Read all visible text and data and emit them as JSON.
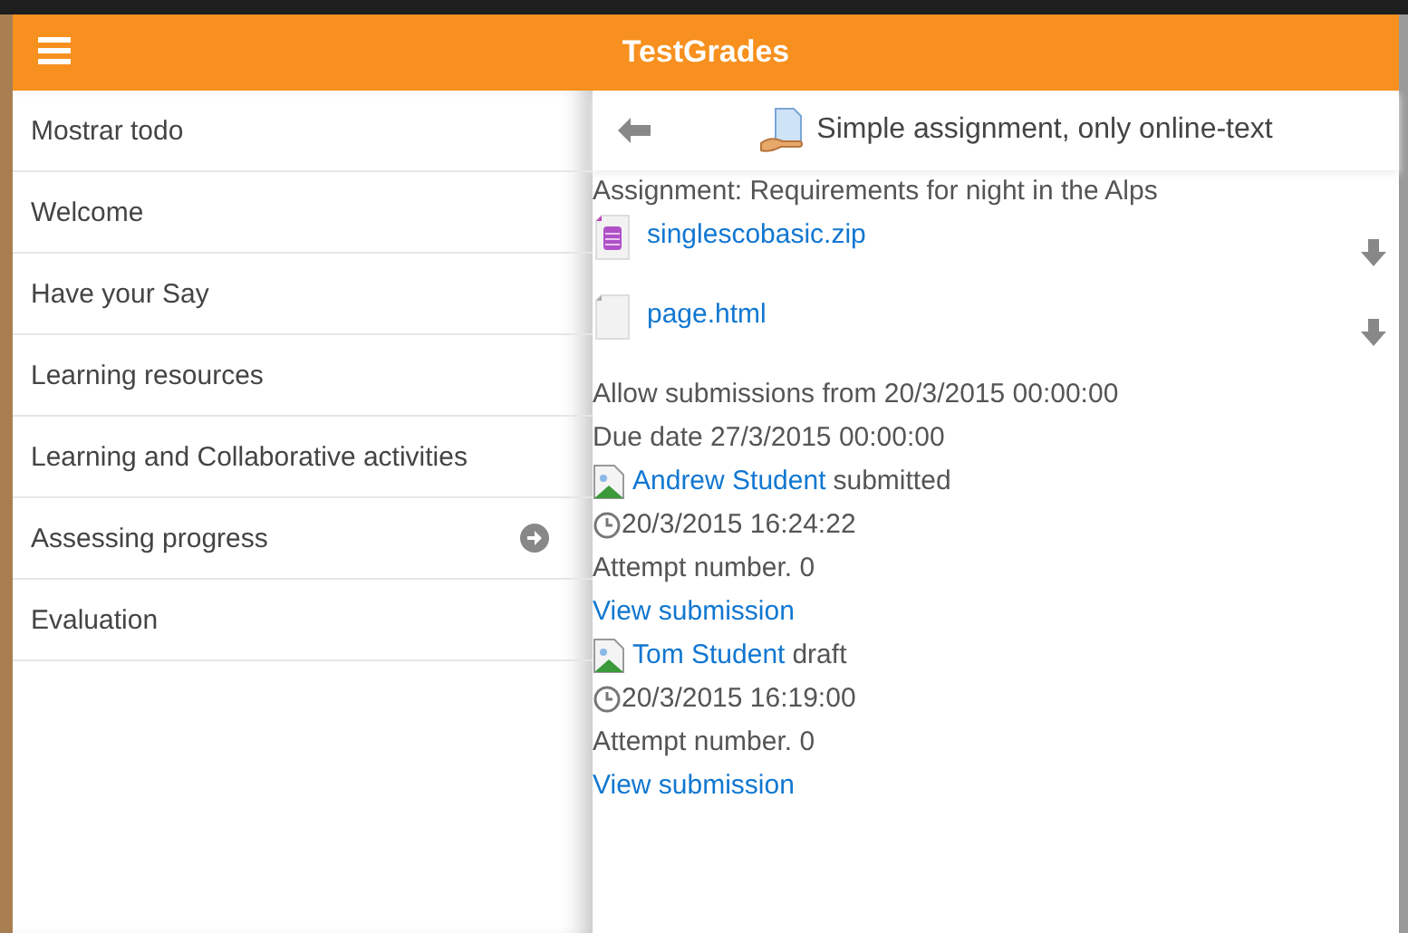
{
  "header": {
    "title": "TestGrades"
  },
  "sidebar": {
    "items": [
      {
        "label": "Mostrar todo",
        "has_arrow": false
      },
      {
        "label": "Welcome",
        "has_arrow": false
      },
      {
        "label": "Have your Say",
        "has_arrow": false
      },
      {
        "label": "Learning resources",
        "has_arrow": false
      },
      {
        "label": "Learning and Collaborative activities",
        "has_arrow": false
      },
      {
        "label": "Assessing progress",
        "has_arrow": true
      },
      {
        "label": "Evaluation",
        "has_arrow": false
      }
    ]
  },
  "content": {
    "title": "Simple assignment, only online-text",
    "assignment": "Assignment: Requirements for night in the Alps",
    "files": [
      {
        "name": "singlescobasic.zip",
        "kind": "archive"
      },
      {
        "name": "page.html",
        "kind": "document"
      }
    ],
    "dates": [
      "Allow submissions from 20/3/2015 00:00:00",
      "Due date 27/3/2015 00:00:00"
    ],
    "submissions": [
      {
        "student": "Andrew Student",
        "status": "submitted",
        "time": "20/3/2015 16:24:22",
        "attempt": "Attempt number. 0",
        "link": "View submission"
      },
      {
        "student": "Tom Student",
        "status": "draft",
        "time": "20/3/2015 16:19:00",
        "attempt": "Attempt number. 0",
        "link": "View submission"
      }
    ]
  }
}
